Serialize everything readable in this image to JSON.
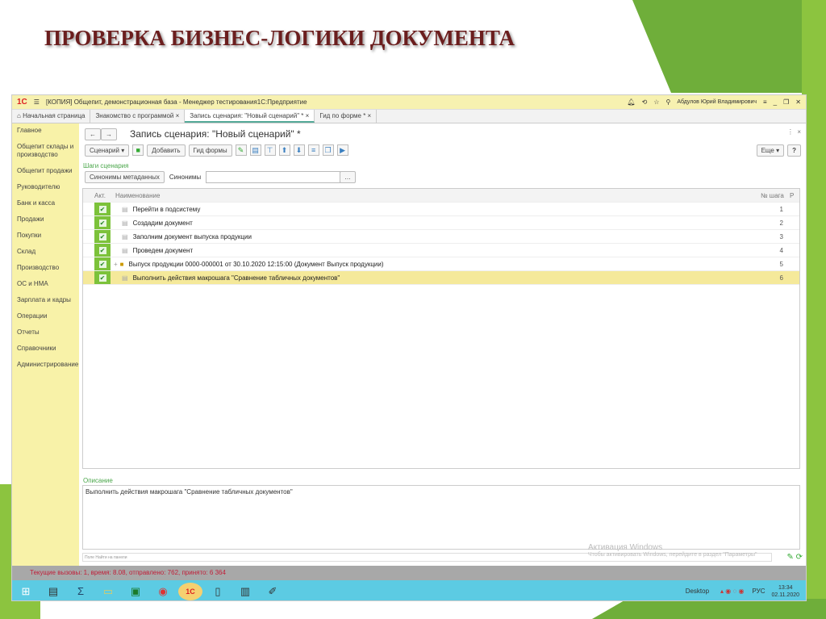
{
  "slide_title": "ПРОВЕРКА БИЗНЕС-ЛОГИКИ ДОКУМЕНТА",
  "window": {
    "logo": "1С",
    "title": "[КОПИЯ] Общепит, демонстрационная база - Менеджер тестирования1С:Предприятие",
    "user": "Абдулов Юрий Владимирович"
  },
  "tabs": [
    "Начальная страница",
    "Знакомство с программой",
    "Запись сценария: \"Новый сценарий\" *",
    "Гид по форме *"
  ],
  "sidebar": [
    "Главное",
    "Общепит склады и производство",
    "Общепит продажи",
    "Руководителю",
    "Банк и касса",
    "Продажи",
    "Покупки",
    "Склад",
    "Производство",
    "ОС и НМА",
    "Зарплата и кадры",
    "Операции",
    "Отчеты",
    "Справочники",
    "Администрирование"
  ],
  "form": {
    "title": "Запись сценария: \"Новый сценарий\" *",
    "scenario_btn": "Сценарий",
    "add_btn": "Добавить",
    "guide_btn": "Гид формы",
    "more_btn": "Еще",
    "help_btn": "?",
    "steps_label": "Шаги сценария",
    "synonyms_btn": "Синонимы метаданных",
    "synonyms_label": "Синонимы",
    "synonyms_value": ""
  },
  "table": {
    "headers": {
      "act": "Акт.",
      "name": "Наименование",
      "step": "№ шага",
      "r": "Р"
    },
    "rows": [
      {
        "name": "Перейти в подсистему",
        "step": "1"
      },
      {
        "name": "Создадим документ",
        "step": "2"
      },
      {
        "name": "Заполним документ выпуска продукции",
        "step": "3"
      },
      {
        "name": "Проведем документ",
        "step": "4"
      },
      {
        "name": "Выпуск продукции 0000-000001 от 30.10.2020 12:15:00 (Документ Выпуск продукции)",
        "step": "5"
      },
      {
        "name": "Выполнить действия макрошага \"Сравнение табличных документов\"",
        "step": "6"
      }
    ]
  },
  "description": {
    "label": "Описание",
    "text": "Выполнить действия макрошага \"Сравнение табличных документов\"",
    "search_placeholder": "Поле Найти на панели"
  },
  "watermark": {
    "line1": "Активация Windows",
    "line2": "Чтобы активировать Windows, перейдите в раздел \"Параметры\""
  },
  "status": "Текущие вызовы: 1, время: 8.08, отправлено: 762, принято: 6 364",
  "taskbar": {
    "desktop": "Desktop",
    "lang": "РУС",
    "time": "13:34",
    "date": "02.11.2020"
  }
}
